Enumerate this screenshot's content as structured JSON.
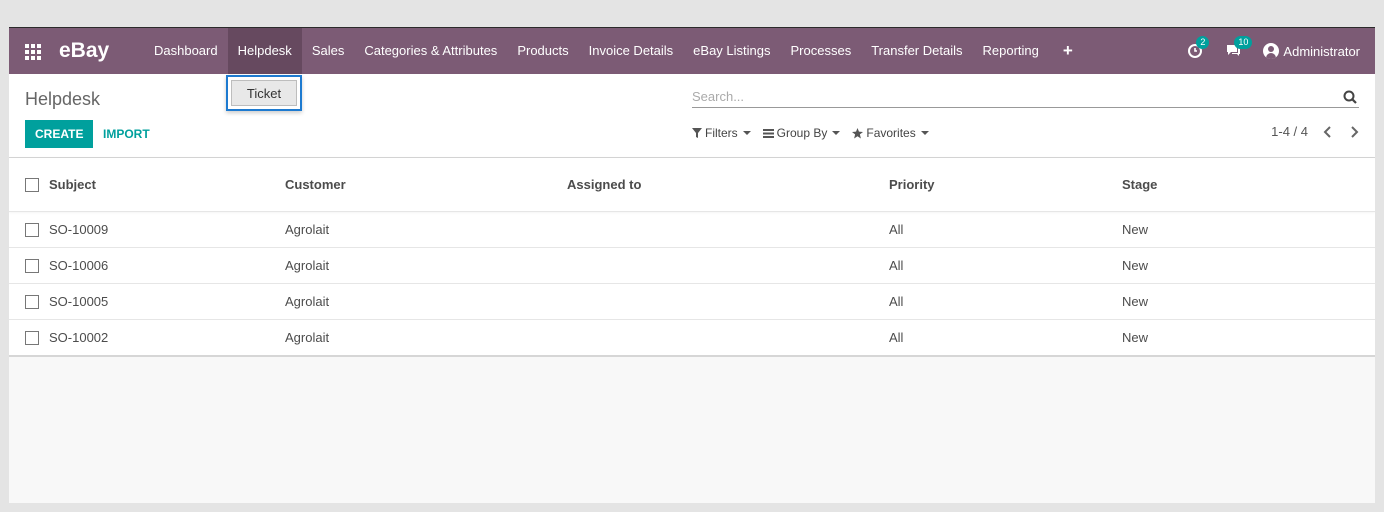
{
  "navbar": {
    "brand": "eBay",
    "menu": [
      "Dashboard",
      "Helpdesk",
      "Sales",
      "Categories & Attributes",
      "Products",
      "Invoice Details",
      "eBay Listings",
      "Processes",
      "Transfer Details",
      "Reporting"
    ],
    "plus": "+",
    "activity_badge": "2",
    "messages_badge": "10",
    "user": "Administrator"
  },
  "dropdown": {
    "item": "Ticket"
  },
  "control_panel": {
    "breadcrumb": "Helpdesk",
    "create": "CREATE",
    "import": "IMPORT",
    "search_placeholder": "Search...",
    "filters": "Filters",
    "group_by": "Group By",
    "favorites": "Favorites",
    "pager": "1-4 / 4"
  },
  "table": {
    "columns": [
      "Subject",
      "Customer",
      "Assigned to",
      "Priority",
      "Stage"
    ],
    "rows": [
      [
        "SO-10009",
        "Agrolait",
        "",
        "All",
        "New"
      ],
      [
        "SO-10006",
        "Agrolait",
        "",
        "All",
        "New"
      ],
      [
        "SO-10005",
        "Agrolait",
        "",
        "All",
        "New"
      ],
      [
        "SO-10002",
        "Agrolait",
        "",
        "All",
        "New"
      ]
    ]
  },
  "colors": {
    "navbar": "#7c5b75",
    "accent": "#00a09d",
    "focus": "#1d7ad0"
  }
}
